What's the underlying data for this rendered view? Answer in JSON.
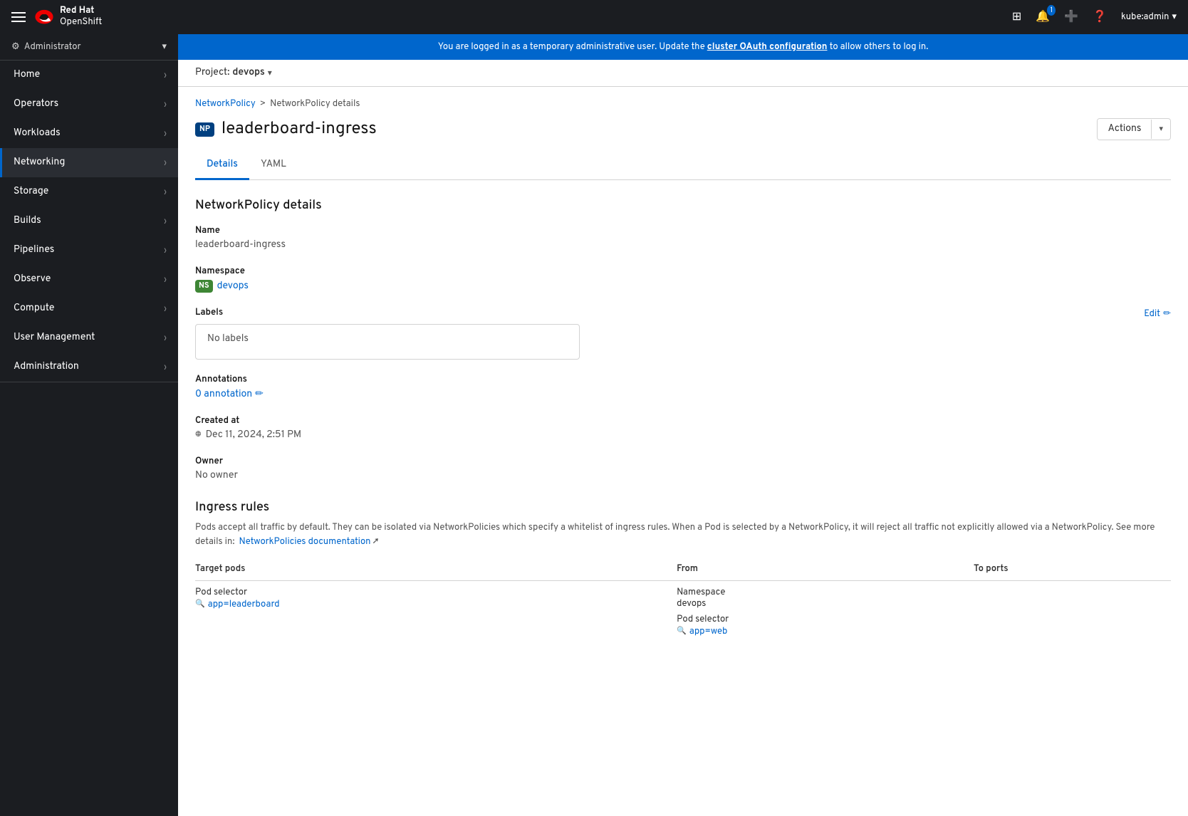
{
  "topnav": {
    "brand_line1": "Red Hat",
    "brand_line2": "OpenShift",
    "notifications_count": "1",
    "user": "kube:admin"
  },
  "banner": {
    "message": "You are logged in as a temporary administrative user. Update the ",
    "link_text": "cluster OAuth configuration",
    "message_suffix": " to allow others to log in."
  },
  "project": {
    "label": "Project:",
    "name": "devops"
  },
  "breadcrumb": {
    "parent": "NetworkPolicy",
    "separator": ">",
    "current": "NetworkPolicy details"
  },
  "page": {
    "badge": "NP",
    "title": "leaderboard-ingress",
    "actions_label": "Actions"
  },
  "tabs": [
    {
      "label": "Details",
      "active": true
    },
    {
      "label": "YAML",
      "active": false
    }
  ],
  "details": {
    "section_title": "NetworkPolicy details",
    "name_label": "Name",
    "name_value": "leaderboard-ingress",
    "namespace_label": "Namespace",
    "namespace_badge": "NS",
    "namespace_value": "devops",
    "labels_label": "Labels",
    "labels_edit": "Edit",
    "labels_empty": "No labels",
    "annotations_label": "Annotations",
    "annotations_value": "0 annotation",
    "created_label": "Created at",
    "created_value": "Dec 11, 2024, 2:51 PM",
    "owner_label": "Owner",
    "owner_value": "No owner"
  },
  "ingress": {
    "title": "Ingress rules",
    "description": "Pods accept all traffic by default. They can be isolated via NetworkPolicies which specify a whitelist of ingress rules. When a Pod is selected by a NetworkPolicy, it will reject all traffic not explicitly allowed via a NetworkPolicy. See more details in:",
    "docs_link": "NetworkPolicies documentation",
    "col_target": "Target pods",
    "col_from": "From",
    "col_ports": "To ports",
    "row_target_label": "Pod selector",
    "row_target_value": "app=leaderboard",
    "row_from_namespace": "Namespace",
    "row_from_ns_value": "devops",
    "row_from_pod_label": "Pod selector",
    "row_from_pod_value": "app=web"
  },
  "sidebar": {
    "admin_label": "Administrator",
    "items": [
      {
        "label": "Home",
        "active": false
      },
      {
        "label": "Operators",
        "active": false
      },
      {
        "label": "Workloads",
        "active": false
      },
      {
        "label": "Networking",
        "active": true
      },
      {
        "label": "Storage",
        "active": false
      },
      {
        "label": "Builds",
        "active": false
      },
      {
        "label": "Pipelines",
        "active": false
      },
      {
        "label": "Observe",
        "active": false
      },
      {
        "label": "Compute",
        "active": false
      },
      {
        "label": "User Management",
        "active": false
      },
      {
        "label": "Administration",
        "active": false
      }
    ]
  }
}
